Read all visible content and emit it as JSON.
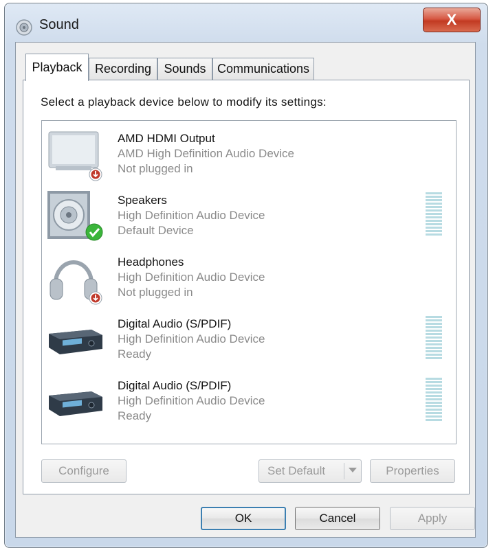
{
  "window": {
    "title": "Sound",
    "close_label": "X"
  },
  "tabs": [
    {
      "label": "Playback",
      "active": true
    },
    {
      "label": "Recording",
      "active": false
    },
    {
      "label": "Sounds",
      "active": false
    },
    {
      "label": "Communications",
      "active": false
    }
  ],
  "playback": {
    "instruction": "Select a playback device below to modify its settings:",
    "devices": [
      {
        "name": "AMD HDMI Output",
        "description": "AMD High Definition Audio Device",
        "status": "Not plugged in",
        "icon": "monitor-icon",
        "badge": "unplugged-badge-icon",
        "meter": false
      },
      {
        "name": "Speakers",
        "description": "High Definition Audio Device",
        "status": "Default Device",
        "icon": "speaker-icon",
        "badge": "default-check-icon",
        "meter": true
      },
      {
        "name": "Headphones",
        "description": "High Definition Audio Device",
        "status": "Not plugged in",
        "icon": "headphones-icon",
        "badge": "unplugged-badge-icon",
        "meter": false
      },
      {
        "name": "Digital Audio (S/PDIF)",
        "description": "High Definition Audio Device",
        "status": "Ready",
        "icon": "receiver-icon",
        "badge": "",
        "meter": true
      },
      {
        "name": "Digital Audio (S/PDIF)",
        "description": "High Definition Audio Device",
        "status": "Ready",
        "icon": "receiver-icon",
        "badge": "",
        "meter": true
      }
    ],
    "buttons": {
      "configure": "Configure",
      "set_default": "Set Default",
      "properties": "Properties"
    }
  },
  "footer": {
    "ok": "OK",
    "cancel": "Cancel",
    "apply": "Apply"
  },
  "colors": {
    "default_check": "#3bb53b",
    "unplugged": "#c0392b",
    "meter": "#b7dbe2",
    "close": "#c94a32"
  }
}
